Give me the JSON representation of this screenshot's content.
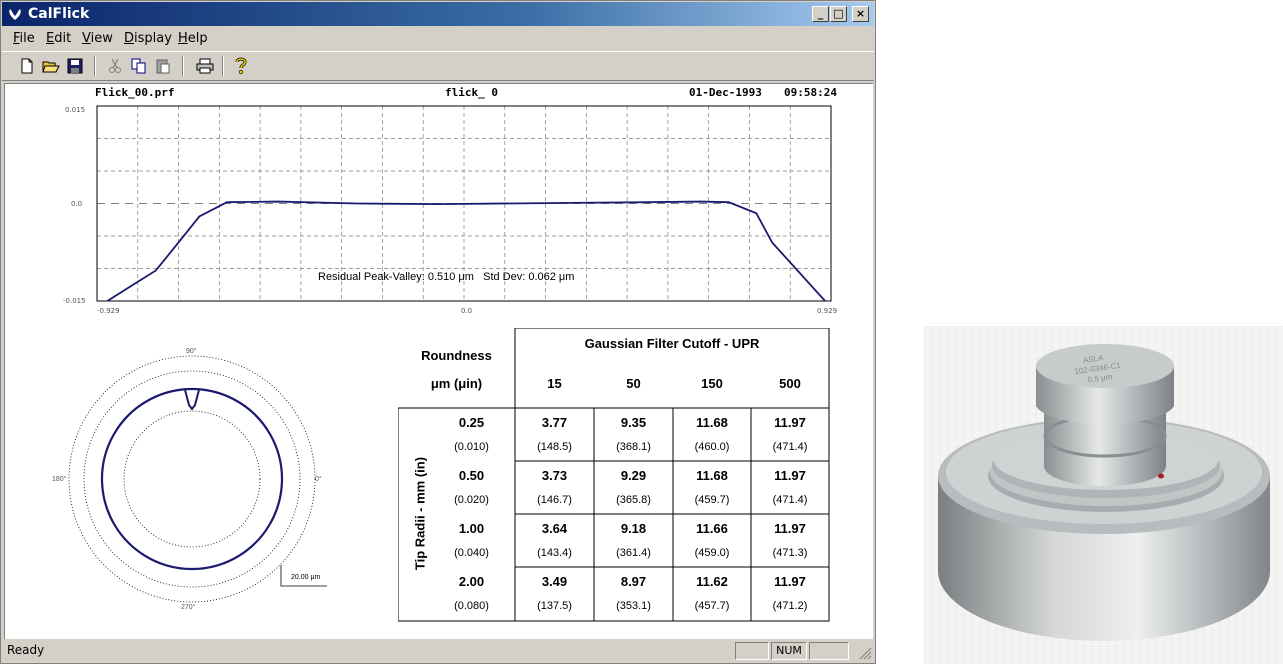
{
  "window": {
    "title": "CalFlick",
    "menu": [
      "File",
      "Edit",
      "View",
      "Display",
      "Help"
    ],
    "menu_underline": [
      "F",
      "E",
      "V",
      "D",
      "H"
    ]
  },
  "profile": {
    "file_name": "Flick_00.prf",
    "trace_name": "flick_ 0",
    "date": "01-Dec-1993",
    "time": "09:58:24",
    "y_top_label": "0.015",
    "y_mid_label": "0.0",
    "y_bottom_label": "-0.015",
    "x_left_label": "-0.929",
    "x_mid_label": "0.0",
    "x_right_label": "0.929",
    "annotation": "Residual Peak-Valley: 0.510 μm   Std Dev: 0.062 μm"
  },
  "chart_data": {
    "type": "line",
    "x_range": [
      -0.929,
      0.929
    ],
    "y_range": [
      -0.015,
      0.015
    ],
    "grid": true,
    "series": [
      {
        "x": [
          -0.929,
          -0.78,
          -0.74,
          -0.67,
          -0.6,
          -0.47,
          -0.27,
          -0.065,
          0.27,
          0.47,
          0.6,
          0.67,
          0.74,
          0.78,
          0.929
        ],
        "y": [
          -0.016,
          -0.0103,
          -0.0073,
          -0.002,
          0.0002,
          0.0003,
          0.0,
          -0.0001,
          0.0001,
          0.0002,
          0.0003,
          0.0002,
          -0.0015,
          -0.006,
          -0.016
        ]
      }
    ]
  },
  "polar": {
    "label_top": "90°",
    "label_left": "180°",
    "label_right": "0°",
    "label_bottom": "270°",
    "scale_label": "20.00 μm"
  },
  "table": {
    "header_title": "Gaussian Filter Cutoff - UPR",
    "roundness_label_1": "Roundness",
    "roundness_label_2": "μm (μin)",
    "cutoffs": [
      "15",
      "50",
      "150",
      "500"
    ],
    "row_axis_label": "Tip Radii - mm (in)",
    "rows": [
      {
        "radius": "0.25",
        "radius_in": "(0.010)",
        "values": [
          "3.77",
          "9.35",
          "11.68",
          "11.97"
        ],
        "subvalues": [
          "(148.5)",
          "(368.1)",
          "(460.0)",
          "(471.4)"
        ]
      },
      {
        "radius": "0.50",
        "radius_in": "(0.020)",
        "values": [
          "3.73",
          "9.29",
          "11.68",
          "11.97"
        ],
        "subvalues": [
          "(146.7)",
          "(365.8)",
          "(459.7)",
          "(471.4)"
        ]
      },
      {
        "radius": "1.00",
        "radius_in": "(0.040)",
        "values": [
          "3.64",
          "9.18",
          "11.66",
          "11.97"
        ],
        "subvalues": [
          "(143.4)",
          "(361.4)",
          "(459.0)",
          "(471.3)"
        ]
      },
      {
        "radius": "2.00",
        "radius_in": "(0.080)",
        "values": [
          "3.49",
          "8.97",
          "11.62",
          "11.97"
        ],
        "subvalues": [
          "(137.5)",
          "(353.1)",
          "(457.7)",
          "(471.2)"
        ]
      }
    ]
  },
  "status": {
    "text": "Ready",
    "num": "NUM"
  },
  "icons": [
    "app-icon",
    "new-file-icon",
    "open-folder-icon",
    "save-icon",
    "cut-icon",
    "copy-icon",
    "paste-icon",
    "print-icon",
    "help-icon"
  ]
}
